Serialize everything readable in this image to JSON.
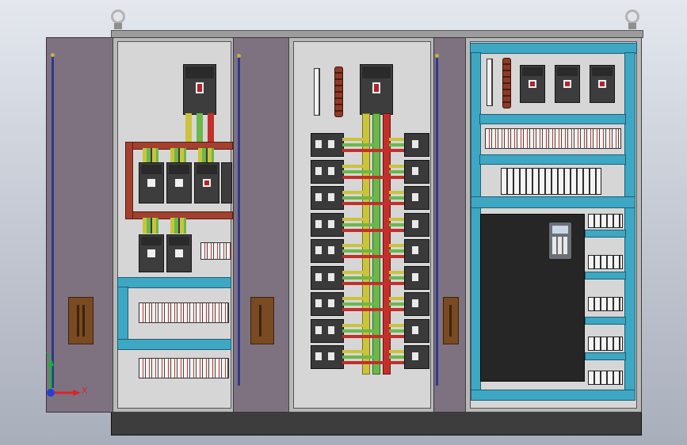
{
  "axis_triad": {
    "x_label": "X",
    "y_label": "Y",
    "x_color": "#d8262a",
    "y_color": "#1fae3a",
    "origin_color": "#2a3fd0"
  },
  "colors": {
    "background_top": "#e4e8ee",
    "door": "#7e7281",
    "cabinet_panel": "#b9b9b9",
    "busbar_red": "#a3402e",
    "rail_teal": "#3ea7c3",
    "plinth": "#3d3d3d",
    "wire_yellow": "#c9c43c",
    "wire_green": "#6bb84a",
    "wire_red": "#c32f2a"
  },
  "icons": {
    "lifting_eye_left": "ring-icon",
    "lifting_eye_right": "ring-icon",
    "door_handle": "handle-icon",
    "vfd_keypad": "keypad-icon"
  }
}
